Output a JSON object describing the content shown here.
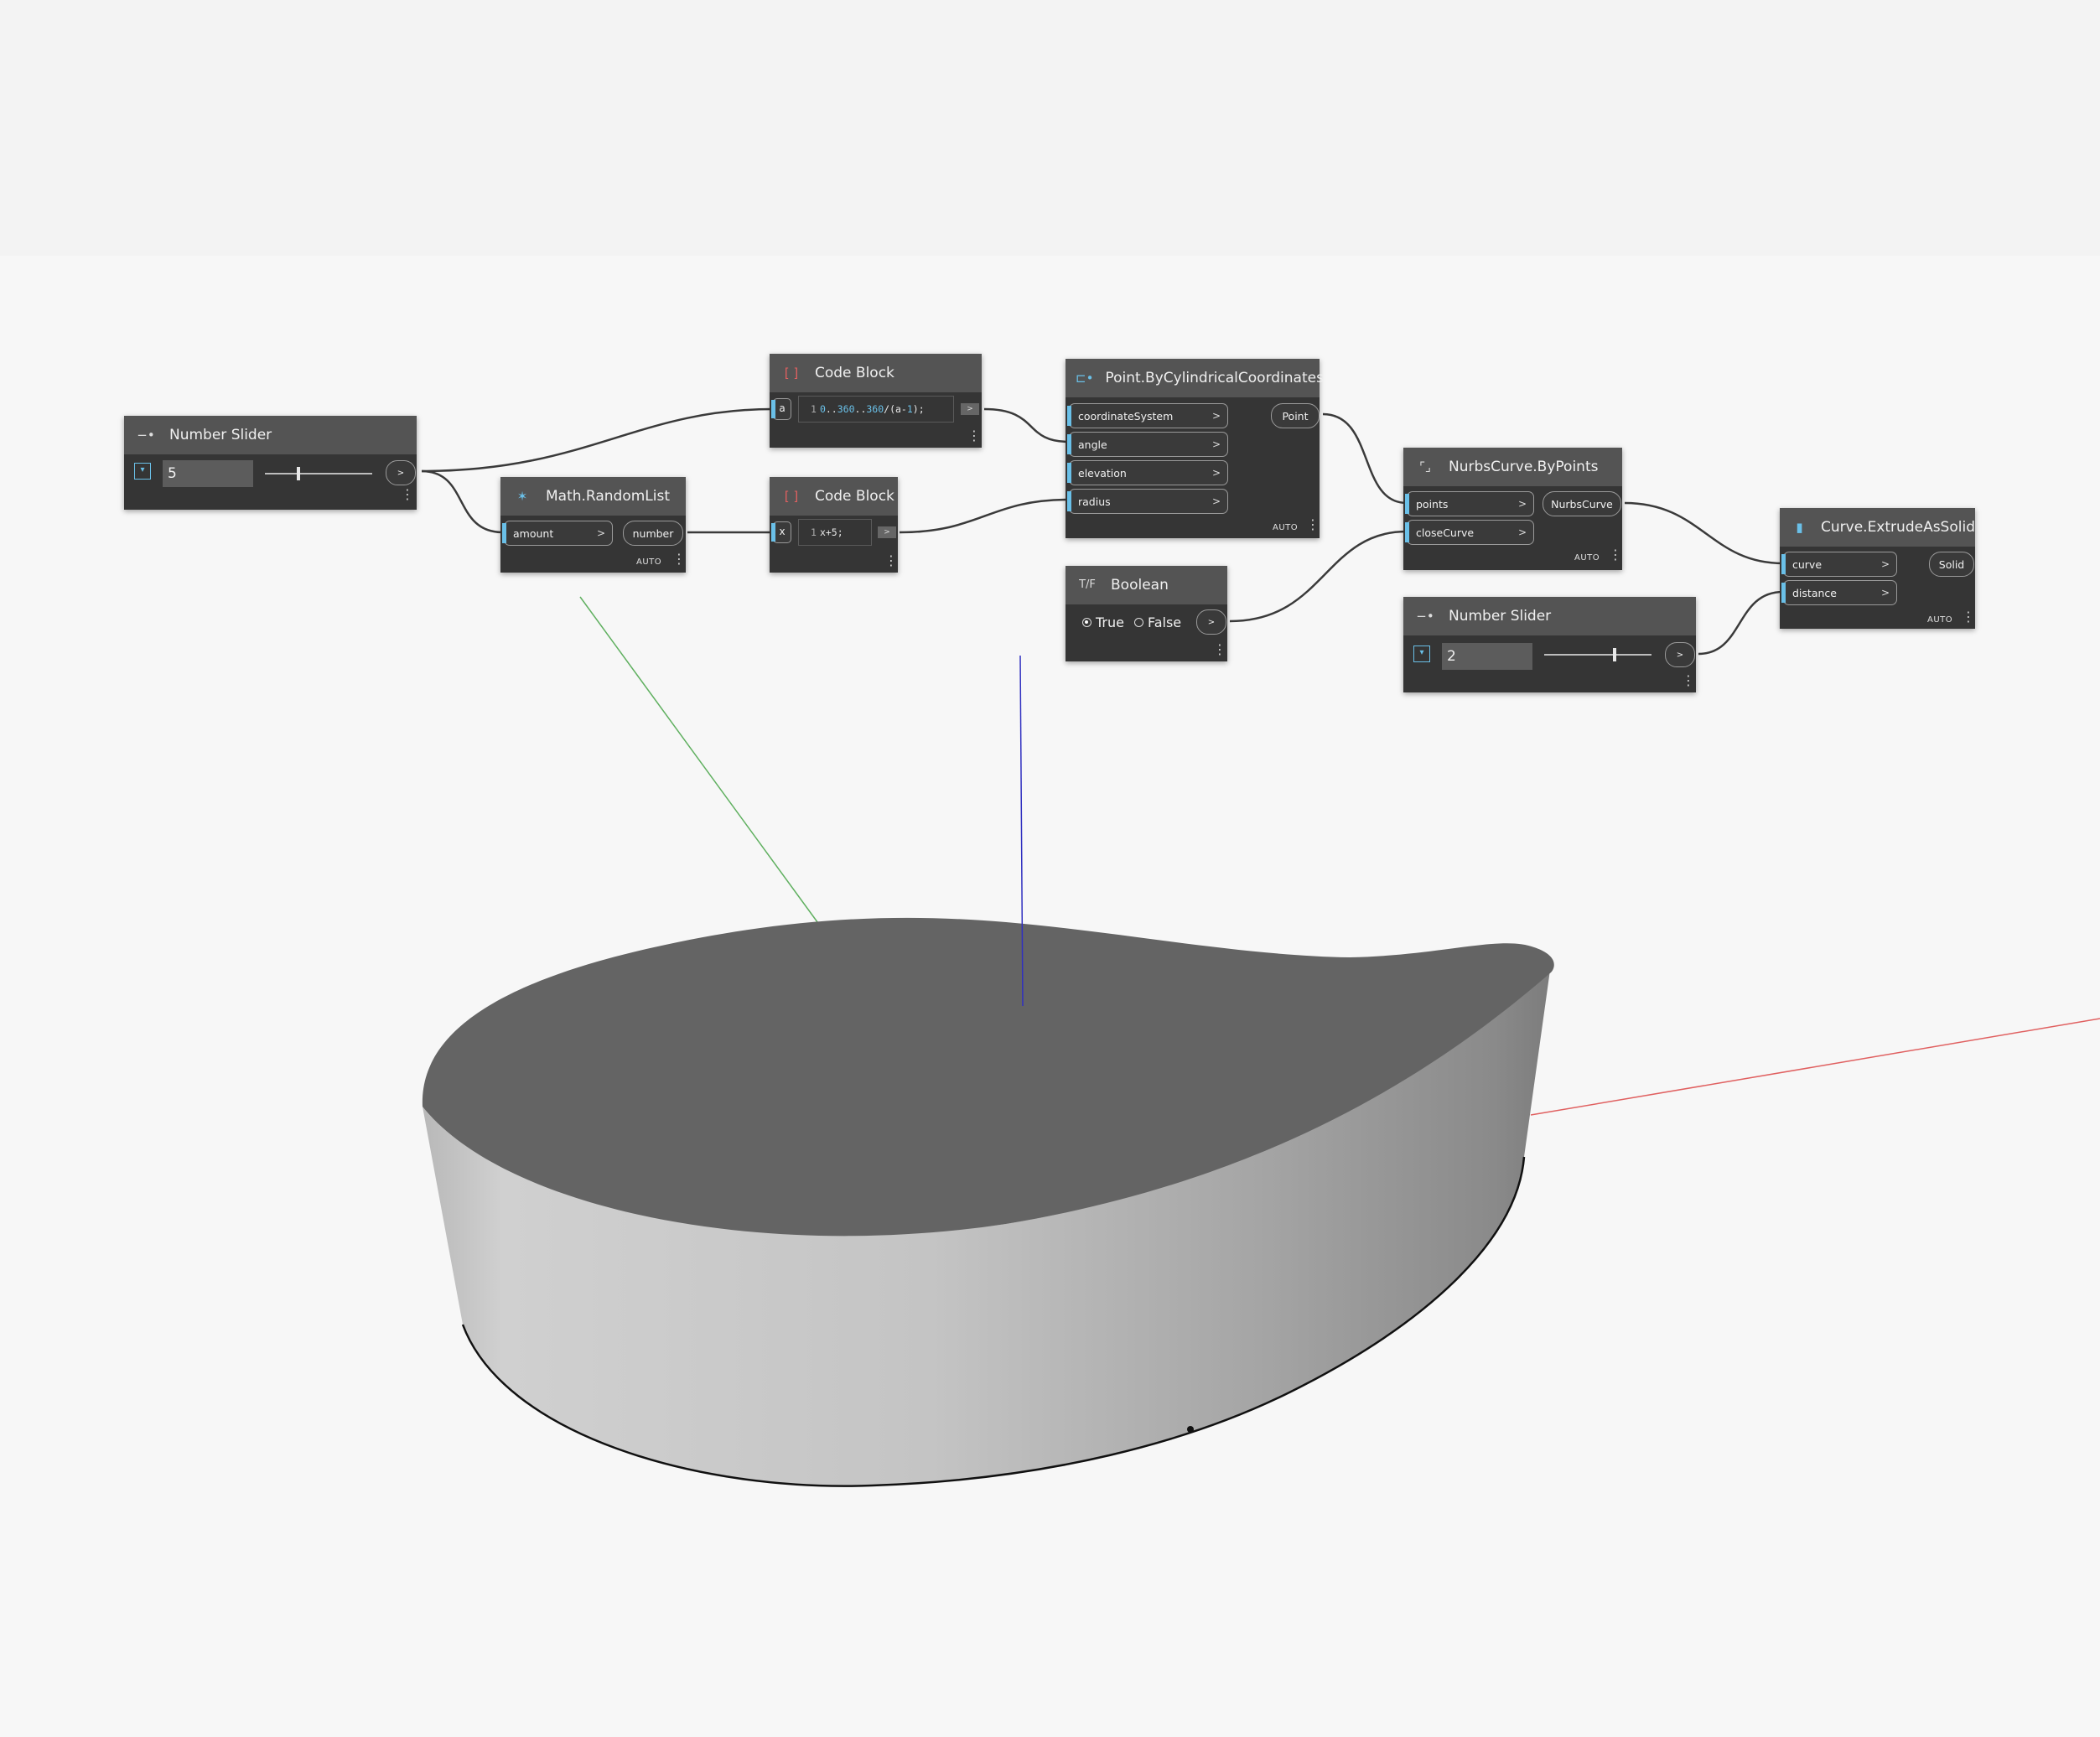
{
  "nodes": {
    "number_slider_1": {
      "title": "Number Slider",
      "value": "5",
      "output": ">"
    },
    "code_block_1": {
      "title": "Code Block",
      "input": "a",
      "line_no": "1",
      "code_parts": [
        "0",
        "..",
        "360",
        "..",
        "360",
        "/(a-",
        "1",
        ");"
      ],
      "output": ">"
    },
    "math_random_list": {
      "title": "Math.RandomList",
      "input": "amount",
      "output": "number",
      "lacing": "AUTO"
    },
    "code_block_2": {
      "title": "Code Block",
      "input": "x",
      "line_no": "1",
      "code": "x+5;",
      "output": ">"
    },
    "point_cyl": {
      "title": "Point.ByCylindricalCoordinates",
      "inputs": [
        "coordinateSystem",
        "angle",
        "elevation",
        "radius"
      ],
      "output": "Point",
      "lacing": "AUTO"
    },
    "boolean": {
      "title": "Boolean",
      "true_label": "True",
      "false_label": "False",
      "selected": "True",
      "output": ">"
    },
    "nurbs": {
      "title": "NurbsCurve.ByPoints",
      "inputs": [
        "points",
        "closeCurve"
      ],
      "output": "NurbsCurve",
      "lacing": "AUTO"
    },
    "number_slider_2": {
      "title": "Number Slider",
      "value": "2",
      "output": ">"
    },
    "extrude": {
      "title": "Curve.ExtrudeAsSolid",
      "inputs": [
        "curve",
        "distance"
      ],
      "output": "Solid",
      "lacing": "AUTO"
    }
  },
  "chevron": ">",
  "menu_glyph": "⋮",
  "colors": {
    "node_body": "#353535",
    "node_header": "#545454",
    "port_accent": "#6ac0e8",
    "wire": "#3a3a3a",
    "axis_x": "#e06060",
    "axis_y": "#60b060",
    "axis_z": "#3030c0",
    "solid_top": "#646464",
    "background": "#f7f7f7"
  },
  "icons": {
    "slider": "slider-icon",
    "code_block": "code-block-icon",
    "random_list": "random-list-icon",
    "point": "point-icon",
    "boolean": "boolean-icon",
    "nurbs": "nurbs-curve-icon",
    "extrude": "extrude-icon"
  }
}
